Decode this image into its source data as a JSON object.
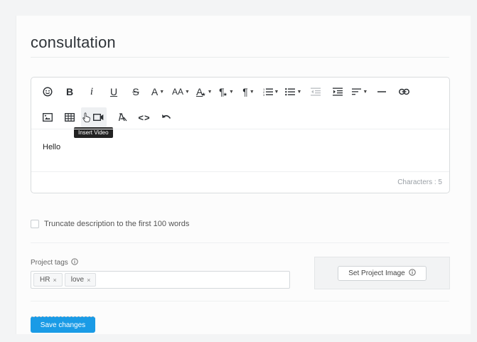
{
  "page": {
    "title": "consultation"
  },
  "editor": {
    "content": "Hello",
    "char_count": "Characters : 5",
    "tooltip": "Insert Video",
    "toolbar_row1": [
      {
        "name": "emoji-icon"
      },
      {
        "name": "bold-icon",
        "glyph": "B"
      },
      {
        "name": "italic-icon",
        "glyph": "i"
      },
      {
        "name": "underline-icon",
        "glyph": "U"
      },
      {
        "name": "strikethrough-icon",
        "glyph": "S"
      },
      {
        "name": "font-color-icon",
        "glyph": "A"
      },
      {
        "name": "font-size-icon",
        "glyph": "AA"
      },
      {
        "name": "text-style-icon",
        "glyph": "A"
      },
      {
        "name": "paragraph-style-icon",
        "glyph": "¶"
      },
      {
        "name": "paragraph-format-icon",
        "glyph": "¶"
      },
      {
        "name": "ordered-list-icon"
      },
      {
        "name": "unordered-list-icon"
      },
      {
        "name": "outdent-icon"
      },
      {
        "name": "indent-icon"
      },
      {
        "name": "align-icon"
      },
      {
        "name": "horizontal-line-icon"
      },
      {
        "name": "link-icon"
      }
    ],
    "toolbar_row2": [
      {
        "name": "insert-image-icon"
      },
      {
        "name": "insert-table-icon"
      },
      {
        "name": "insert-video-icon"
      },
      {
        "name": "clear-formatting-icon"
      },
      {
        "name": "code-view-icon",
        "glyph": "<>"
      },
      {
        "name": "undo-icon"
      }
    ]
  },
  "truncate": {
    "label": "Truncate description to the first 100 words",
    "checked": false
  },
  "tags": {
    "label": "Project tags",
    "items": [
      {
        "label": "HR",
        "remove": "×"
      },
      {
        "label": "love",
        "remove": "×"
      }
    ]
  },
  "image": {
    "button_label": "Set Project Image"
  },
  "actions": {
    "save_label": "Save changes"
  },
  "colors": {
    "primary": "#1a9be6",
    "tooltip_bg": "#222222"
  }
}
